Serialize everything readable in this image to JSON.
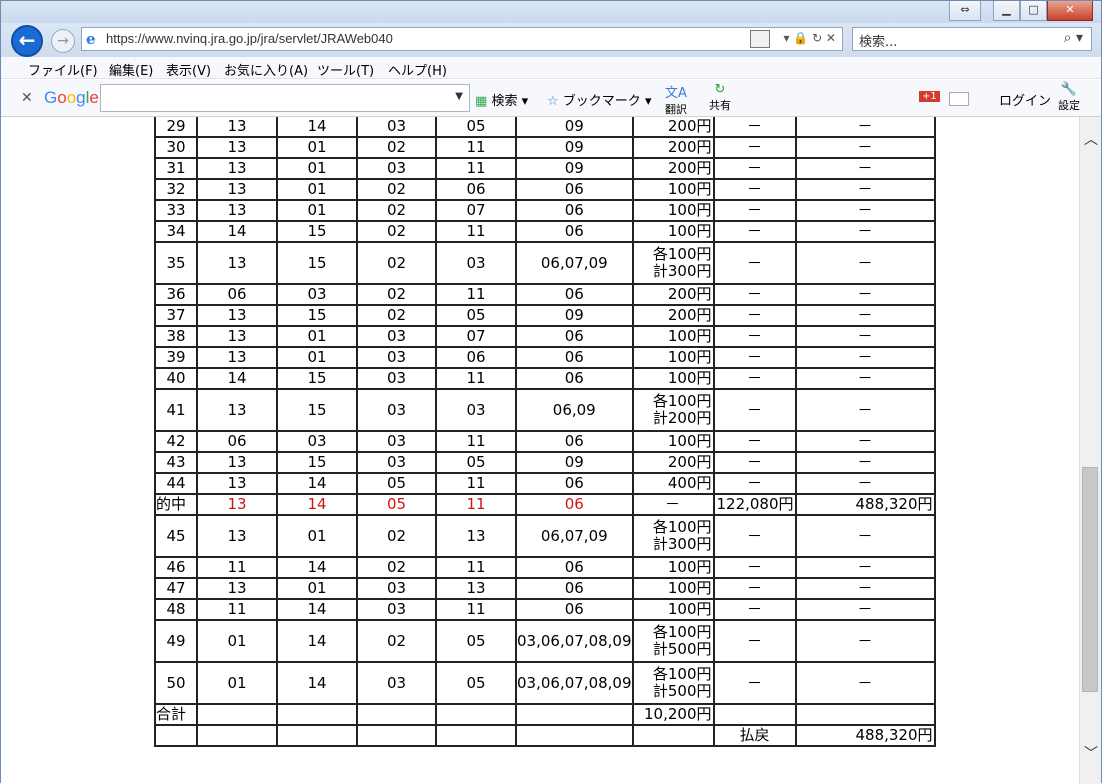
{
  "browser": {
    "url": "https://www.nvinq.jra.go.jp/jra/servlet/JRAWeb040",
    "search_placeholder": "検索...",
    "menu": [
      "ファイル(F)",
      "編集(E)",
      "表示(V)",
      "お気に入り(A)",
      "ツール(T)",
      "ヘルプ(H)"
    ],
    "google_toolbar": {
      "logo": "Google",
      "search_label": "検索",
      "bookmark_label": "ブックマーク",
      "translate_label": "翻訳",
      "share_label": "共有",
      "login_label": "ログイン",
      "settings_label": "設定",
      "gplus_label": "+1"
    }
  },
  "table": {
    "rows": [
      {
        "no": "29",
        "c1": "13",
        "c2": "14",
        "c3": "03",
        "c4": "05",
        "c5": "09",
        "amt": "200円",
        "c7": "－",
        "c8": "－"
      },
      {
        "no": "30",
        "c1": "13",
        "c2": "01",
        "c3": "02",
        "c4": "11",
        "c5": "09",
        "amt": "200円",
        "c7": "－",
        "c8": "－"
      },
      {
        "no": "31",
        "c1": "13",
        "c2": "01",
        "c3": "03",
        "c4": "11",
        "c5": "09",
        "amt": "200円",
        "c7": "－",
        "c8": "－"
      },
      {
        "no": "32",
        "c1": "13",
        "c2": "01",
        "c3": "02",
        "c4": "06",
        "c5": "06",
        "amt": "100円",
        "c7": "－",
        "c8": "－"
      },
      {
        "no": "33",
        "c1": "13",
        "c2": "01",
        "c3": "02",
        "c4": "07",
        "c5": "06",
        "amt": "100円",
        "c7": "－",
        "c8": "－"
      },
      {
        "no": "34",
        "c1": "14",
        "c2": "15",
        "c3": "02",
        "c4": "11",
        "c5": "06",
        "amt": "100円",
        "c7": "－",
        "c8": "－"
      },
      {
        "no": "35",
        "c1": "13",
        "c2": "15",
        "c3": "02",
        "c4": "03",
        "c5": "06,07,09",
        "amt": "各100円",
        "amt2": "計300円",
        "c7": "－",
        "c8": "－"
      },
      {
        "no": "36",
        "c1": "06",
        "c2": "03",
        "c3": "02",
        "c4": "11",
        "c5": "06",
        "amt": "200円",
        "c7": "－",
        "c8": "－"
      },
      {
        "no": "37",
        "c1": "13",
        "c2": "15",
        "c3": "02",
        "c4": "05",
        "c5": "09",
        "amt": "200円",
        "c7": "－",
        "c8": "－"
      },
      {
        "no": "38",
        "c1": "13",
        "c2": "01",
        "c3": "03",
        "c4": "07",
        "c5": "06",
        "amt": "100円",
        "c7": "－",
        "c8": "－"
      },
      {
        "no": "39",
        "c1": "13",
        "c2": "01",
        "c3": "03",
        "c4": "06",
        "c5": "06",
        "amt": "100円",
        "c7": "－",
        "c8": "－"
      },
      {
        "no": "40",
        "c1": "14",
        "c2": "15",
        "c3": "03",
        "c4": "11",
        "c5": "06",
        "amt": "100円",
        "c7": "－",
        "c8": "－"
      },
      {
        "no": "41",
        "c1": "13",
        "c2": "15",
        "c3": "03",
        "c4": "03",
        "c5": "06,09",
        "amt": "各100円",
        "amt2": "計200円",
        "c7": "－",
        "c8": "－"
      },
      {
        "no": "42",
        "c1": "06",
        "c2": "03",
        "c3": "03",
        "c4": "11",
        "c5": "06",
        "amt": "100円",
        "c7": "－",
        "c8": "－"
      },
      {
        "no": "43",
        "c1": "13",
        "c2": "15",
        "c3": "03",
        "c4": "05",
        "c5": "09",
        "amt": "200円",
        "c7": "－",
        "c8": "－"
      },
      {
        "no": "44",
        "c1": "13",
        "c2": "14",
        "c3": "05",
        "c4": "11",
        "c5": "06",
        "amt": "400円",
        "c7": "－",
        "c8": "－"
      },
      {
        "no": "的中",
        "c1": "13",
        "c2": "14",
        "c3": "05",
        "c4": "11",
        "c5": "06",
        "amt": "－",
        "c7": "122,080円",
        "c8": "488,320円",
        "hit": true
      },
      {
        "no": "45",
        "c1": "13",
        "c2": "01",
        "c3": "02",
        "c4": "13",
        "c5": "06,07,09",
        "amt": "各100円",
        "amt2": "計300円",
        "c7": "－",
        "c8": "－"
      },
      {
        "no": "46",
        "c1": "11",
        "c2": "14",
        "c3": "02",
        "c4": "11",
        "c5": "06",
        "amt": "100円",
        "c7": "－",
        "c8": "－"
      },
      {
        "no": "47",
        "c1": "13",
        "c2": "01",
        "c3": "03",
        "c4": "13",
        "c5": "06",
        "amt": "100円",
        "c7": "－",
        "c8": "－"
      },
      {
        "no": "48",
        "c1": "11",
        "c2": "14",
        "c3": "03",
        "c4": "11",
        "c5": "06",
        "amt": "100円",
        "c7": "－",
        "c8": "－"
      },
      {
        "no": "49",
        "c1": "01",
        "c2": "14",
        "c3": "02",
        "c4": "05",
        "c5": "03,06,07,08,09",
        "amt": "各100円",
        "amt2": "計500円",
        "c7": "－",
        "c8": "－"
      },
      {
        "no": "50",
        "c1": "01",
        "c2": "14",
        "c3": "03",
        "c4": "05",
        "c5": "03,06,07,08,09",
        "amt": "各100円",
        "amt2": "計500円",
        "c7": "－",
        "c8": "－"
      }
    ],
    "total_label": "合計",
    "total_amount": "10,200円",
    "payout_label": "払戻",
    "payout_amount": "488,320円"
  },
  "colors": {
    "hit_text": "#d21414",
    "back_button": "#1b6ad2"
  }
}
